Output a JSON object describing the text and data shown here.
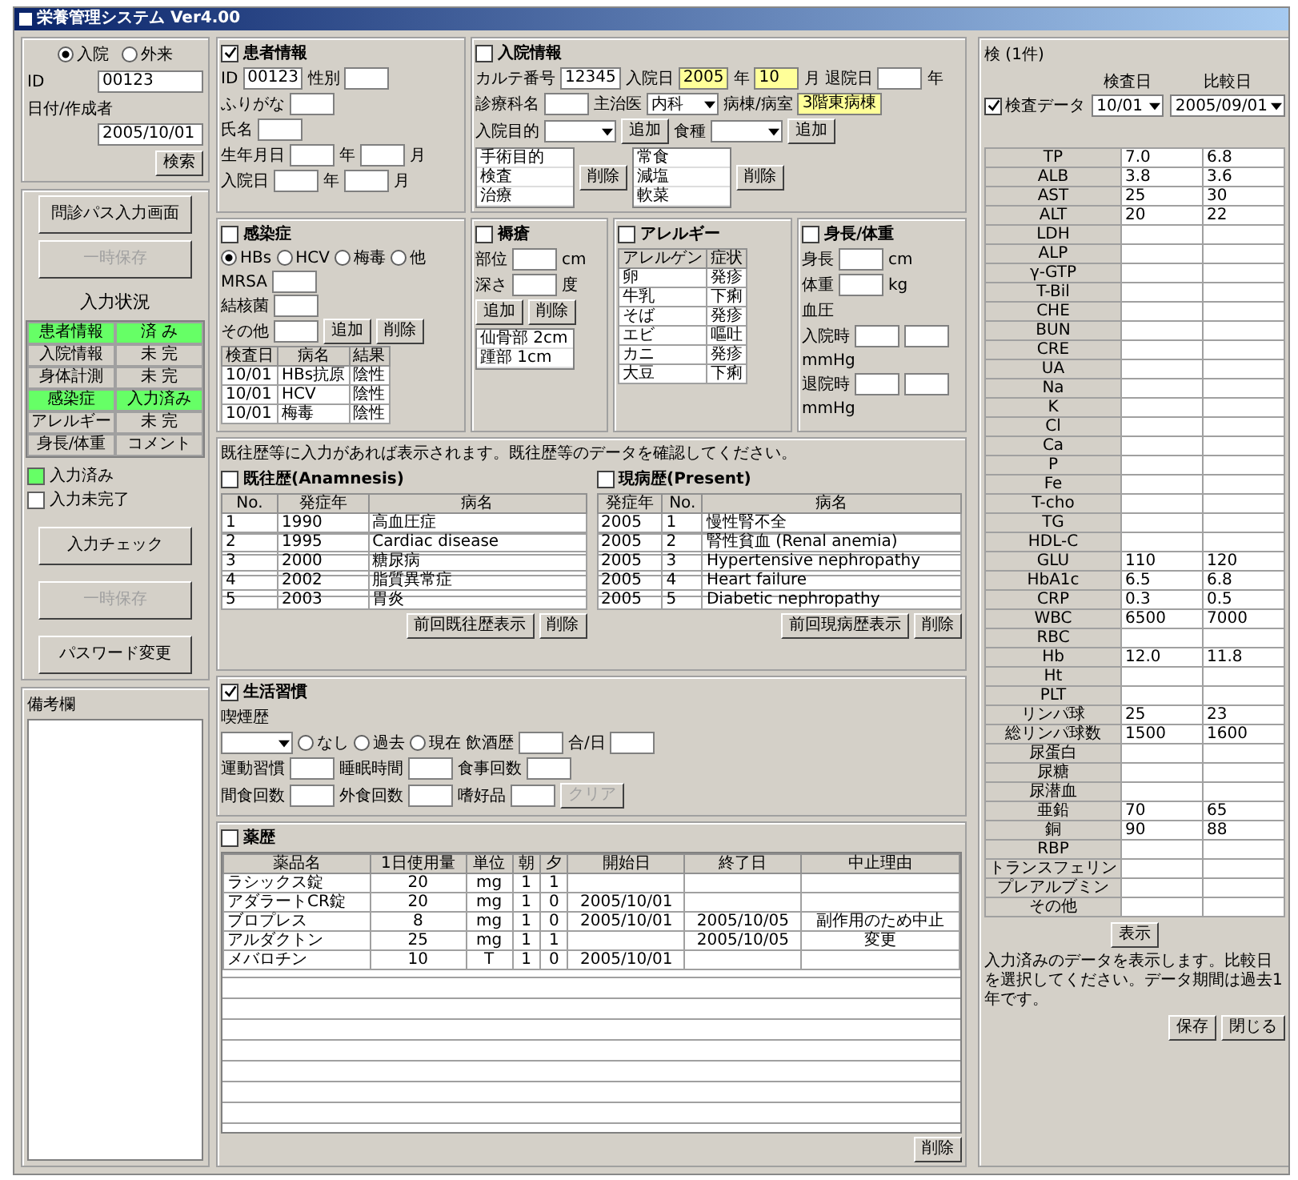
{
  "window": {
    "title": "栄養管理システム Ver4.00"
  },
  "left": {
    "radios": [
      {
        "label": "入院",
        "selected": true
      },
      {
        "label": "外来",
        "selected": false
      }
    ],
    "fields": [
      {
        "label": "ID",
        "value": "00123"
      },
      {
        "label": "日付/作成者",
        "value": "2005/10/01"
      }
    ],
    "search_button": "検索",
    "top_buttons": [
      {
        "label": "問診パス入力画面",
        "disabled": false
      },
      {
        "label": "一時保存",
        "disabled": true
      }
    ],
    "status_title": "入力状況",
    "status": [
      {
        "label": "患者情報",
        "value": "済 み",
        "done": true
      },
      {
        "label": "入院情報",
        "value": "未 完",
        "done": false
      },
      {
        "label": "身体計測",
        "value": "未 完",
        "done": false
      },
      {
        "label": "感染症",
        "value": "入力済み",
        "done": true
      },
      {
        "label": "アレルギー",
        "value": "未 完",
        "done": false
      },
      {
        "label": "身長/体重",
        "value": "コメント",
        "done": false
      }
    ],
    "legend": [
      {
        "label": "入力済み",
        "done": true
      },
      {
        "label": "入力未完了",
        "done": false
      }
    ],
    "bottom_buttons": [
      {
        "label": "入力チェック",
        "disabled": false
      },
      {
        "label": "一時保存",
        "disabled": true
      },
      {
        "label": "パスワード変更",
        "disabled": false
      }
    ],
    "memo_label": "備考欄"
  },
  "sections": [
    {
      "title": "患者情報",
      "checked": true,
      "lines": [
        [
          {
            "kind": "label",
            "text": "ID"
          },
          {
            "kind": "input",
            "value": "00123"
          },
          {
            "kind": "label",
            "text": "性別"
          },
          {
            "kind": "input"
          }
        ],
        [
          {
            "kind": "label",
            "text": "ふりがな"
          },
          {
            "kind": "input"
          }
        ],
        [
          {
            "kind": "label",
            "text": "氏名"
          },
          {
            "kind": "input"
          }
        ],
        [
          {
            "kind": "label",
            "text": "生年月日"
          },
          {
            "kind": "input"
          },
          {
            "kind": "unit",
            "text": "年"
          },
          {
            "kind": "input"
          },
          {
            "kind": "unit",
            "text": "月"
          }
        ],
        [
          {
            "kind": "label",
            "text": "入院日"
          },
          {
            "kind": "input"
          },
          {
            "kind": "unit",
            "text": "年"
          },
          {
            "kind": "input"
          },
          {
            "kind": "unit",
            "text": "月"
          }
        ]
      ]
    },
    {
      "title": "入院情報",
      "checked": false,
      "lines": [
        [
          {
            "kind": "label",
            "text": "カルテ番号"
          },
          {
            "kind": "input",
            "value": "12345"
          },
          {
            "kind": "label",
            "text": "入院日"
          },
          {
            "kind": "input",
            "value": "2005",
            "highlighted": true
          },
          {
            "kind": "unit",
            "text": "年"
          },
          {
            "kind": "input",
            "value": "10",
            "highlighted": true
          },
          {
            "kind": "unit",
            "text": "月"
          },
          {
            "kind": "label",
            "text": "退院日"
          },
          {
            "kind": "input"
          },
          {
            "kind": "unit",
            "text": "年"
          }
        ],
        [
          {
            "kind": "label",
            "text": "診療科名"
          },
          {
            "kind": "input"
          },
          {
            "kind": "label",
            "text": "主治医"
          },
          {
            "kind": "select",
            "value": "内科"
          },
          {
            "kind": "label",
            "text": "病棟/病室"
          },
          {
            "kind": "input",
            "value": "3階東病棟",
            "highlighted": true
          }
        ],
        [
          {
            "kind": "label",
            "text": "入院目的"
          },
          {
            "kind": "select"
          },
          {
            "kind": "button",
            "text": "追加",
            "disabled": false
          },
          {
            "kind": "label",
            "text": "食種"
          },
          {
            "kind": "select"
          },
          {
            "kind": "button",
            "text": "追加",
            "disabled": false
          }
        ],
        [
          {
            "kind": "list",
            "items": [
              "手術目的",
              "検査",
              "治療"
            ]
          },
          {
            "kind": "button",
            "text": "削除",
            "disabled": false
          },
          {
            "kind": "list",
            "items": [
              "常食",
              "減塩",
              "軟菜"
            ]
          },
          {
            "kind": "button",
            "text": "削除",
            "disabled": false
          }
        ]
      ]
    },
    {
      "title": "感染症",
      "checked": false,
      "lines": [
        [
          {
            "kind": "radio",
            "text": "HBs",
            "selected": true
          },
          {
            "kind": "radio",
            "text": "HCV",
            "selected": false
          },
          {
            "kind": "radio",
            "text": "梅毒",
            "selected": false
          },
          {
            "kind": "radio",
            "text": "他",
            "selected": false
          }
        ],
        [
          {
            "kind": "label",
            "text": "MRSA"
          },
          {
            "kind": "input"
          }
        ],
        [
          {
            "kind": "label",
            "text": "結核菌"
          },
          {
            "kind": "input"
          }
        ],
        [
          {
            "kind": "label",
            "text": "その他"
          },
          {
            "kind": "input"
          },
          {
            "kind": "button",
            "text": "追加",
            "disabled": false
          },
          {
            "kind": "button",
            "text": "削除",
            "disabled": false
          }
        ],
        [
          {
            "kind": "table",
            "columns": [
              "検査日",
              "病名",
              "結果"
            ],
            "rows": [
              [
                "10/01",
                "HBs抗原",
                "陰性"
              ],
              [
                "10/01",
                "HCV",
                "陰性"
              ],
              [
                "10/01",
                "梅毒",
                "陰性"
              ]
            ]
          }
        ]
      ]
    },
    {
      "title": "褥瘡",
      "checked": false,
      "lines": [
        [
          {
            "kind": "label",
            "text": "部位"
          },
          {
            "kind": "input"
          },
          {
            "kind": "unit",
            "text": "cm"
          }
        ],
        [
          {
            "kind": "label",
            "text": "深さ"
          },
          {
            "kind": "input"
          },
          {
            "kind": "unit",
            "text": "度"
          }
        ],
        [
          {
            "kind": "button",
            "text": "追加",
            "disabled": false
          },
          {
            "kind": "button",
            "text": "削除",
            "disabled": false
          }
        ],
        [
          {
            "kind": "list",
            "items": [
              "仙骨部 2cm",
              "踵部 1cm"
            ]
          }
        ]
      ]
    },
    {
      "title": "アレルギー",
      "checked": false,
      "lines": [
        [
          {
            "kind": "table",
            "columns": [
              "アレルゲン",
              "症状"
            ],
            "rows": [
              [
                "卵",
                "発疹"
              ],
              [
                "牛乳",
                "下痢"
              ],
              [
                "そば",
                "発疹"
              ],
              [
                "エビ",
                "嘔吐"
              ],
              [
                "カニ",
                "発疹"
              ],
              [
                "大豆",
                "下痢"
              ]
            ]
          }
        ]
      ]
    },
    {
      "title": "身長/体重",
      "checked": false,
      "lines": [
        [
          {
            "kind": "label",
            "text": "身長"
          },
          {
            "kind": "input"
          },
          {
            "kind": "unit",
            "text": "cm"
          }
        ],
        [
          {
            "kind": "label",
            "text": "体重"
          },
          {
            "kind": "input"
          },
          {
            "kind": "unit",
            "text": "kg"
          }
        ],
        [
          {
            "kind": "label",
            "text": "血圧"
          }
        ],
        [
          {
            "kind": "label",
            "text": "入院時"
          },
          {
            "kind": "input"
          },
          {
            "kind": "input"
          },
          {
            "kind": "unit",
            "text": "mmHg"
          }
        ],
        [
          {
            "kind": "label",
            "text": "退院時"
          },
          {
            "kind": "input"
          },
          {
            "kind": "input"
          },
          {
            "kind": "unit",
            "text": "mmHg"
          }
        ]
      ]
    }
  ],
  "history_note": "既往歴等に入力があれば表示されます。既往歴等のデータを確認してください。",
  "histories": [
    {
      "title": "既往歴(Anamnesis)",
      "checked": false,
      "columns": [
        "No.",
        "発症年",
        "病名"
      ],
      "rows": [
        [
          "1",
          "1990",
          "高血圧症"
        ],
        [
          "2",
          "1995",
          "Cardiac disease"
        ],
        [
          "3",
          "2000",
          "糖尿病"
        ],
        [
          "4",
          "2002",
          "脂質異常症"
        ],
        [
          "5",
          "2003",
          "胃炎"
        ]
      ],
      "buttons": [
        "前回既往歴表示",
        "削除"
      ]
    },
    {
      "title": "現病歴(Present)",
      "checked": false,
      "columns": [
        "発症年",
        "No.",
        "病名"
      ],
      "rows": [
        [
          "2005",
          "1",
          "慢性腎不全"
        ],
        [
          "2005",
          "2",
          "腎性貧血 (Renal anemia)"
        ],
        [
          "2005",
          "3",
          "Hypertensive nephropathy"
        ],
        [
          "2005",
          "4",
          "Heart failure"
        ],
        [
          "2005",
          "5",
          "Diabetic nephropathy"
        ]
      ],
      "buttons": [
        "前回現病歴表示",
        "削除"
      ]
    }
  ],
  "lifestyle": {
    "title": "生活習慣",
    "checked": true,
    "lines": [
      [
        {
          "kind": "label",
          "text": "喫煙歴"
        }
      ],
      [
        {
          "kind": "select"
        },
        {
          "kind": "radio",
          "text": "なし",
          "selected": false
        },
        {
          "kind": "radio",
          "text": "過去",
          "selected": false
        },
        {
          "kind": "radio",
          "text": "現在",
          "selected": false
        },
        {
          "kind": "label",
          "text": "飲酒歴"
        },
        {
          "kind": "input"
        },
        {
          "kind": "label",
          "text": "合/日"
        },
        {
          "kind": "input"
        }
      ],
      [
        {
          "kind": "label",
          "text": "運動習慣"
        },
        {
          "kind": "input"
        },
        {
          "kind": "label",
          "text": "睡眠時間"
        },
        {
          "kind": "input"
        },
        {
          "kind": "label",
          "text": "食事回数"
        },
        {
          "kind": "input"
        }
      ],
      [
        {
          "kind": "label",
          "text": "間食回数"
        },
        {
          "kind": "input"
        },
        {
          "kind": "label",
          "text": "外食回数"
        },
        {
          "kind": "input"
        },
        {
          "kind": "label",
          "text": "嗜好品"
        },
        {
          "kind": "input"
        },
        {
          "kind": "button",
          "text": "クリア",
          "disabled": true
        }
      ]
    ]
  },
  "drugs": {
    "title": "薬歴",
    "checked": false,
    "columns": [
      "薬品名",
      "1日使用量",
      "単位",
      "朝",
      "夕",
      "開始日",
      "終了日",
      "中止理由"
    ],
    "rows": [
      [
        "ラシックス錠",
        "20",
        "mg",
        "1",
        "1",
        null,
        null,
        null
      ],
      [
        "アダラートCR錠",
        "20",
        "mg",
        "1",
        "0",
        "2005/10/01",
        null,
        null
      ],
      [
        "ブロプレス",
        "8",
        "mg",
        "1",
        "0",
        "2005/10/01",
        "2005/10/05",
        "副作用のため中止"
      ],
      [
        "アルダクトン",
        "25",
        "mg",
        "1",
        "1",
        null,
        "2005/10/05",
        "変更"
      ],
      [
        "メバロチン",
        "10",
        "T",
        "1",
        "0",
        "2005/10/01",
        null,
        null
      ]
    ],
    "button": "削除"
  },
  "labs": {
    "title": "検 (1件)",
    "checkbox": {
      "label": "検査データ",
      "checked": true
    },
    "selects": [
      {
        "label": "検査日",
        "value": "10/01"
      },
      {
        "label": "比較日",
        "value": "2005/09/01"
      }
    ],
    "rows": [
      [
        "TP",
        "7.0",
        "6.8"
      ],
      [
        "ALB",
        "3.8",
        "3.6"
      ],
      [
        "AST",
        "25",
        "30"
      ],
      [
        "ALT",
        "20",
        "22"
      ],
      [
        "LDH",
        null,
        null
      ],
      [
        "ALP",
        null,
        null
      ],
      [
        "γ-GTP",
        null,
        null
      ],
      [
        "T-Bil",
        null,
        null
      ],
      [
        "CHE",
        null,
        null
      ],
      [
        "BUN",
        null,
        null
      ],
      [
        "CRE",
        null,
        null
      ],
      [
        "UA",
        null,
        null
      ],
      [
        "Na",
        null,
        null
      ],
      [
        "K",
        null,
        null
      ],
      [
        "Cl",
        null,
        null
      ],
      [
        "Ca",
        null,
        null
      ],
      [
        "P",
        null,
        null
      ],
      [
        "Fe",
        null,
        null
      ],
      [
        "T-cho",
        null,
        null
      ],
      [
        "TG",
        null,
        null
      ],
      [
        "HDL-C",
        null,
        null
      ],
      [
        "GLU",
        "110",
        "120"
      ],
      [
        "HbA1c",
        "6.5",
        "6.8"
      ],
      [
        "CRP",
        "0.3",
        "0.5"
      ],
      [
        "WBC",
        "6500",
        "7000"
      ],
      [
        "RBC",
        null,
        null
      ],
      [
        "Hb",
        "12.0",
        "11.8"
      ],
      [
        "Ht",
        null,
        null
      ],
      [
        "PLT",
        null,
        null
      ],
      [
        "リンパ球",
        "25",
        "23"
      ],
      [
        "総リンパ球数",
        "1500",
        "1600"
      ],
      [
        "尿蛋白",
        null,
        null
      ],
      [
        "尿糖",
        null,
        null
      ],
      [
        "尿潜血",
        null,
        null
      ],
      [
        "亜鉛",
        "70",
        "65"
      ],
      [
        "銅",
        "90",
        "88"
      ],
      [
        "RBP",
        null,
        null
      ],
      [
        "トランスフェリン",
        null,
        null
      ],
      [
        "プレアルブミン",
        null,
        null
      ],
      [
        "その他",
        null,
        null
      ]
    ],
    "show_button": "表示",
    "note": "入力済みのデータを表示します。比較日を選択してください。データ期間は過去1年です。",
    "buttons": [
      "保存",
      "閉じる"
    ]
  }
}
